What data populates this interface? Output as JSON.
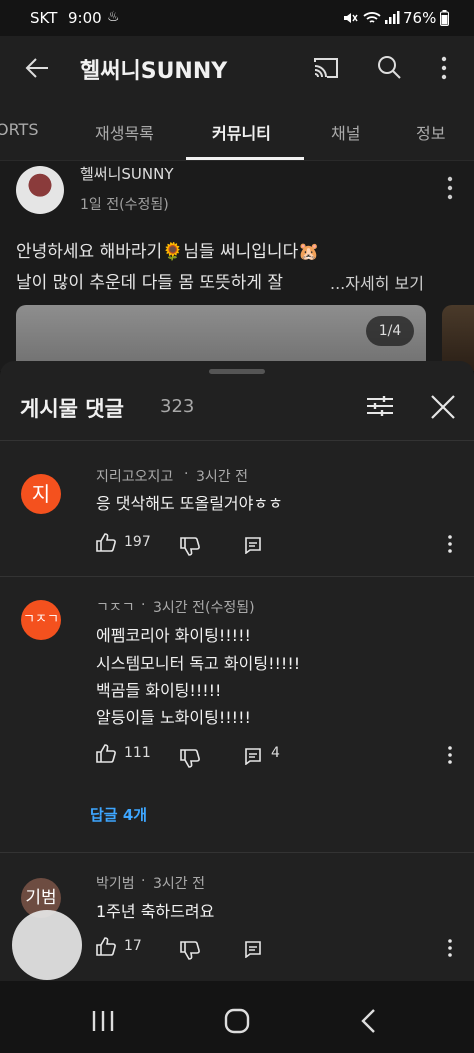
{
  "status": {
    "carrier": "SKT",
    "time": "9:00",
    "battery": "76%"
  },
  "header": {
    "channel_title": "헬써니SUNNY"
  },
  "tabs": [
    "ORTS",
    "재생목록",
    "커뮤니티",
    "채널",
    "정보"
  ],
  "post": {
    "author": "헬써니SUNNY",
    "meta": "1일 전(수정됨)",
    "line1": "안녕하세요 해바라기🌻님들 써니입니다🐹",
    "line2": "날이 많이 추운데 다들 몸 또뜻하게 잘",
    "more": "...자세히 보기",
    "pager": "1/4"
  },
  "sheet": {
    "title": "게시물 댓글",
    "count": "323"
  },
  "comments": [
    {
      "avatar_text": "지",
      "avatar_color": "#f4511e",
      "author": "지리고오지고",
      "time": "3시간 전",
      "lines": [
        "응 댓삭해도 또올릴거야ㅎㅎ"
      ],
      "likes": "197",
      "reply_count": "",
      "replies_link": ""
    },
    {
      "avatar_text": "ㄱㅈㄱ",
      "avatar_color": "#f4511e",
      "author": "ㄱㅈㄱ",
      "time": "3시간 전(수정됨)",
      "lines": [
        "에펨코리아 화이팅!!!!!",
        "시스템모니터 독고 화이팅!!!!!",
        "백곰들 화이팅!!!!!",
        "알등이들 노화이팅!!!!!"
      ],
      "likes": "111",
      "reply_count": "4",
      "replies_link": "답글 4개"
    },
    {
      "avatar_text": "기범",
      "avatar_color": "#6d4c41",
      "author": "박기범",
      "time": "3시간 전",
      "lines": [
        "1주년 축하드려요"
      ],
      "likes": "17",
      "reply_count": "",
      "replies_link": ""
    }
  ],
  "colors": {
    "accent_link": "#3ea6ff",
    "avatar_orange": "#f4511e"
  }
}
